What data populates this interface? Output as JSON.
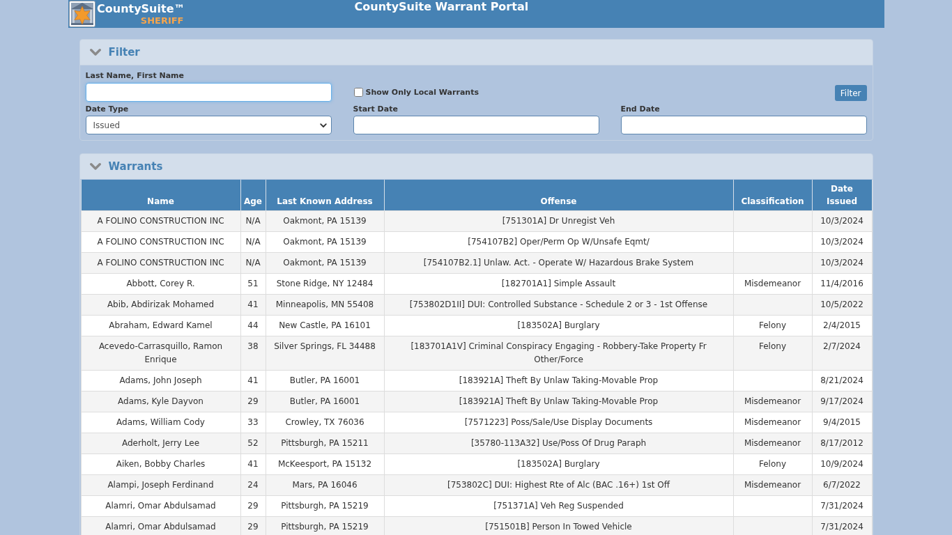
{
  "header": {
    "brand_name": "CountySuite™",
    "brand_tagline": "SHERIFF",
    "title": "CountySuite Warrant Portal"
  },
  "filter_panel": {
    "title": "Filter",
    "expanded": true,
    "name_field": {
      "label": "Last Name, First Name",
      "focused": true
    },
    "local_only": {
      "label": "Show Only Local Warrants",
      "checked": false
    },
    "filter_button": "Filter",
    "date_type": {
      "label": "Date Type",
      "value": "Issued"
    },
    "start_date": {
      "label": "Start Date"
    },
    "end_date": {
      "label": "End Date"
    }
  },
  "warrants_panel": {
    "title": "Warrants",
    "expanded": true,
    "table": {
      "columns": [
        "Name",
        "Age",
        "Last Known Address",
        "Offense",
        "Classification",
        "Date Issued"
      ],
      "rows": [
        {
          "name": "A FOLINO CONSTRUCTION INC",
          "age": "N/A",
          "address": "Oakmont, PA 15139",
          "offense": "[751301A] Dr Unregist Veh",
          "date_issued": "10/3/2024"
        },
        {
          "name": "A FOLINO CONSTRUCTION INC",
          "age": "N/A",
          "address": "Oakmont, PA 15139",
          "offense": "[754107B2] Oper/Perm Op W/Unsafe Eqmt/",
          "date_issued": "10/3/2024"
        },
        {
          "name": "A FOLINO CONSTRUCTION INC",
          "age": "N/A",
          "address": "Oakmont, PA 15139",
          "offense": "[754107B2.1] Unlaw. Act. - Operate W/ Hazardous Brake System",
          "date_issued": "10/3/2024"
        },
        {
          "name": "Abbott, Corey R.",
          "age": "51",
          "address": "Stone Ridge, NY 12484",
          "offense": "[182701A1] Simple Assault",
          "classification": "Misdemeanor",
          "date_issued": "11/4/2016"
        },
        {
          "name": "Abib, Abdirizak Mohamed",
          "age": "41",
          "address": "Minneapolis, MN 55408",
          "offense": "[753802D1II] DUI: Controlled Substance - Schedule 2 or 3 - 1st Offense",
          "date_issued": "10/5/2022"
        },
        {
          "name": "Abraham, Edward Kamel",
          "age": "44",
          "address": "New Castle, PA 16101",
          "offense": "[183502A] Burglary",
          "classification": "Felony",
          "date_issued": "2/4/2015"
        },
        {
          "name": "Acevedo-Carrasquillo, Ramon Enrique",
          "age": "38",
          "address": "Silver Springs, FL 34488",
          "offense": "[183701A1V] Criminal Conspiracy Engaging - Robbery-Take Property Fr Other/Force",
          "classification": "Felony",
          "date_issued": "2/7/2024"
        },
        {
          "name": "Adams, John Joseph",
          "age": "41",
          "address": "Butler, PA 16001",
          "offense": "[183921A] Theft By Unlaw Taking-Movable Prop",
          "date_issued": "8/21/2024"
        },
        {
          "name": "Adams, Kyle Dayvon",
          "age": "29",
          "address": "Butler, PA 16001",
          "offense": "[183921A] Theft By Unlaw Taking-Movable Prop",
          "classification": "Misdemeanor",
          "date_issued": "9/17/2024"
        },
        {
          "name": "Adams, William Cody",
          "age": "33",
          "address": "Crowley, TX 76036",
          "offense": "[7571223] Poss/Sale/Use Display Documents",
          "classification": "Misdemeanor",
          "date_issued": "9/4/2015"
        },
        {
          "name": "Aderholt, Jerry Lee",
          "age": "52",
          "address": "Pittsburgh, PA 15211",
          "offense": "[35780-113A32] Use/Poss Of Drug Paraph",
          "classification": "Misdemeanor",
          "date_issued": "8/17/2012"
        },
        {
          "name": "Aiken, Bobby Charles",
          "age": "41",
          "address": "McKeesport, PA 15132",
          "offense": "[183502A] Burglary",
          "classification": "Felony",
          "date_issued": "10/9/2024"
        },
        {
          "name": "Alampi, Joseph Ferdinand",
          "age": "24",
          "address": "Mars, PA 16046",
          "offense": "[753802C] DUI: Highest Rte of Alc (BAC .16+) 1st Off",
          "classification": "Misdemeanor",
          "date_issued": "6/7/2022"
        },
        {
          "name": "Alamri, Omar Abdulsamad",
          "age": "29",
          "address": "Pittsburgh, PA 15219",
          "offense": "[751371A] Veh Reg Suspended",
          "date_issued": "7/31/2024"
        },
        {
          "name": "Alamri, Omar Abdulsamad",
          "age": "29",
          "address": "Pittsburgh, PA 15219",
          "offense": "[751501B] Person In Towed Vehicle",
          "date_issued": "7/31/2024"
        }
      ]
    }
  }
}
